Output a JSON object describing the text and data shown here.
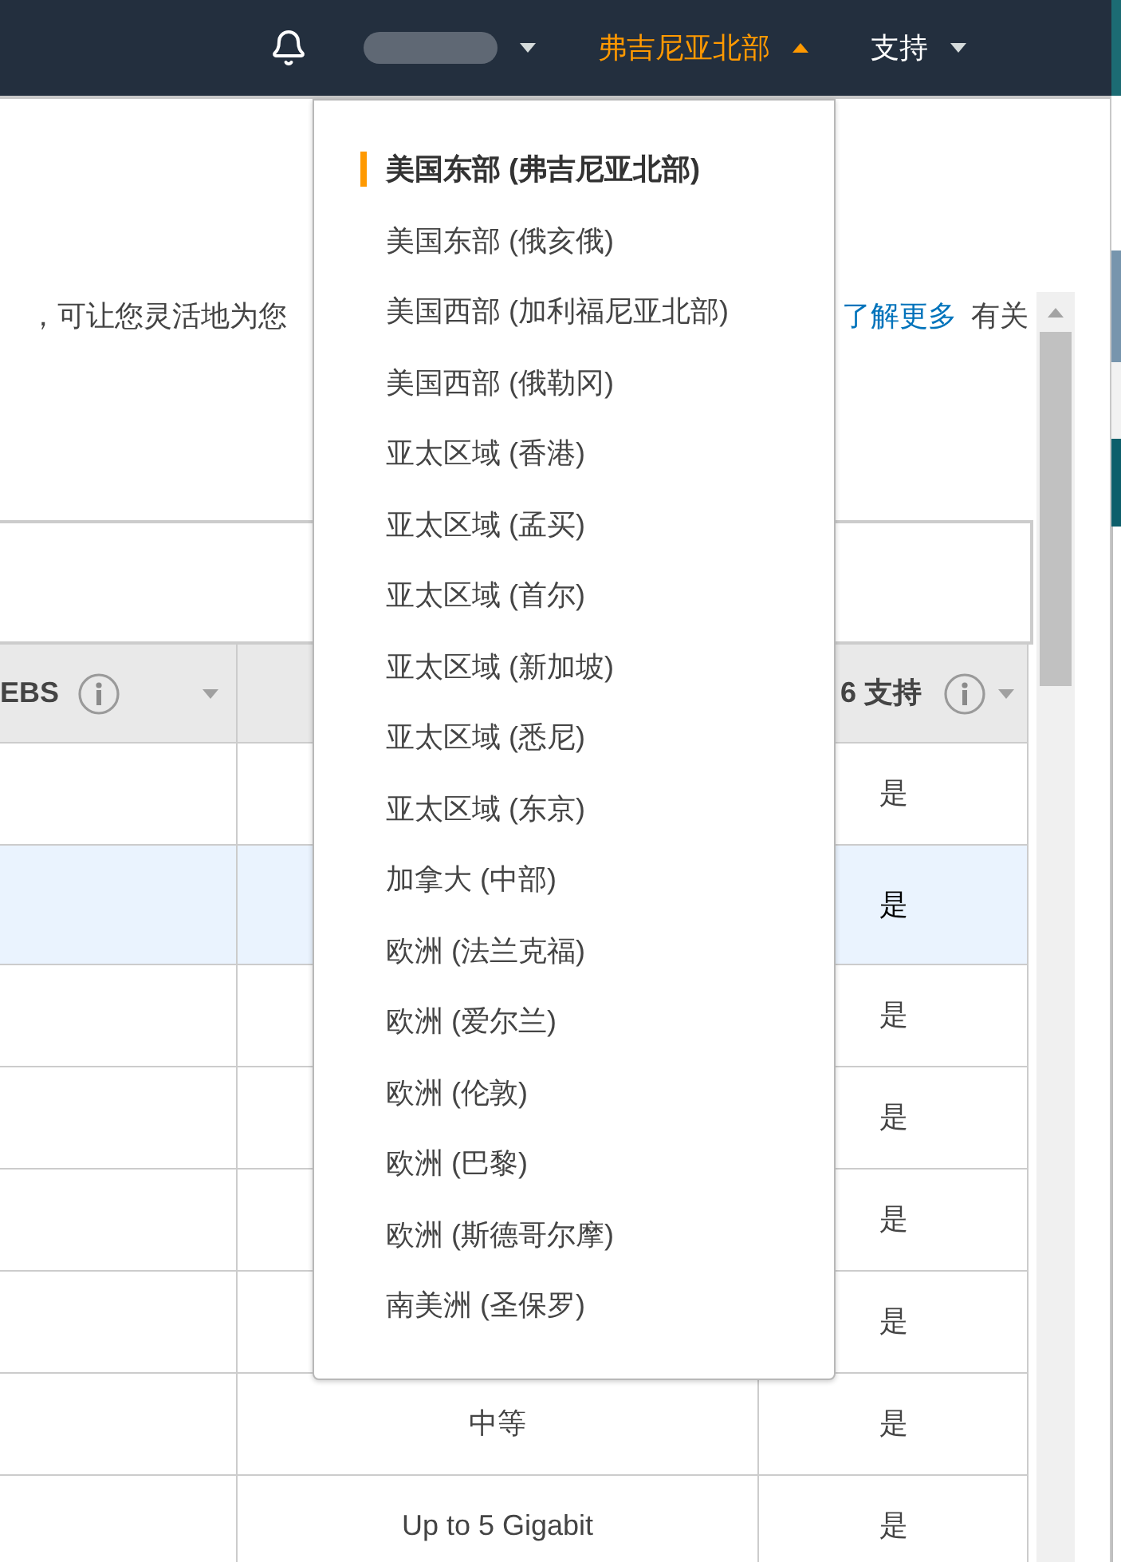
{
  "top_bar": {
    "account_menu": {
      "expanded": false
    },
    "region_menu": {
      "label": "弗吉尼亚北部",
      "expanded": true,
      "items": [
        {
          "label": "美国东部 (弗吉尼亚北部)",
          "selected": true
        },
        {
          "label": "美国东部 (俄亥俄)",
          "selected": false
        },
        {
          "label": "美国西部 (加利福尼亚北部)",
          "selected": false
        },
        {
          "label": "美国西部 (俄勒冈)",
          "selected": false
        },
        {
          "label": "亚太区域 (香港)",
          "selected": false
        },
        {
          "label": "亚太区域 (孟买)",
          "selected": false
        },
        {
          "label": "亚太区域 (首尔)",
          "selected": false
        },
        {
          "label": "亚太区域 (新加坡)",
          "selected": false
        },
        {
          "label": "亚太区域 (悉尼)",
          "selected": false
        },
        {
          "label": "亚太区域 (东京)",
          "selected": false
        },
        {
          "label": "加拿大 (中部)",
          "selected": false
        },
        {
          "label": "欧洲 (法兰克福)",
          "selected": false
        },
        {
          "label": "欧洲 (爱尔兰)",
          "selected": false
        },
        {
          "label": "欧洲 (伦敦)",
          "selected": false
        },
        {
          "label": "欧洲 (巴黎)",
          "selected": false
        },
        {
          "label": "欧洲 (斯德哥尔摩)",
          "selected": false
        },
        {
          "label": "南美洲 (圣保罗)",
          "selected": false
        }
      ]
    },
    "support_menu": {
      "label": "支持",
      "expanded": false
    }
  },
  "intro": {
    "text": "，可让您灵活地为您",
    "link": "了解更多",
    "text_after": "有关"
  },
  "table": {
    "header": {
      "column_1": "EBS",
      "column_3": "6 支持"
    },
    "rows": [
      {
        "selected": false,
        "column_3": "是"
      },
      {
        "selected": true,
        "column_3": "是"
      },
      {
        "selected": false,
        "column_3": "是"
      },
      {
        "selected": false,
        "column_3": "是"
      },
      {
        "selected": false,
        "column_3": "是"
      },
      {
        "selected": false,
        "column_3": "是"
      },
      {
        "selected": false,
        "column_2": "中等",
        "column_3": "是"
      },
      {
        "selected": false,
        "column_2": "Up to 5 Gigabit",
        "column_3": "是"
      }
    ]
  }
}
